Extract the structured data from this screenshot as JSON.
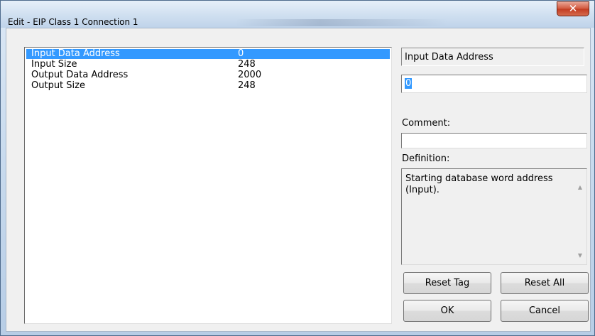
{
  "window": {
    "title": "Edit - EIP Class 1 Connection 1",
    "close_glyph": "✕"
  },
  "list": {
    "rows": [
      {
        "name": "Input Data Address",
        "value": "0",
        "selected": true
      },
      {
        "name": "Input Size",
        "value": "248",
        "selected": false
      },
      {
        "name": "Output Data Address",
        "value": "2000",
        "selected": false
      },
      {
        "name": "Output Size",
        "value": "248",
        "selected": false
      }
    ]
  },
  "editor": {
    "field_name": "Input Data Address",
    "value": "0",
    "comment_label": "Comment:",
    "comment_value": "",
    "definition_label": "Definition:",
    "definition_text": "Starting database word address (Input)."
  },
  "buttons": {
    "reset_tag": "Reset Tag",
    "reset_all": "Reset All",
    "ok": "OK",
    "cancel": "Cancel"
  },
  "colors": {
    "selection": "#3399ff",
    "close_button": "#c23d22"
  }
}
